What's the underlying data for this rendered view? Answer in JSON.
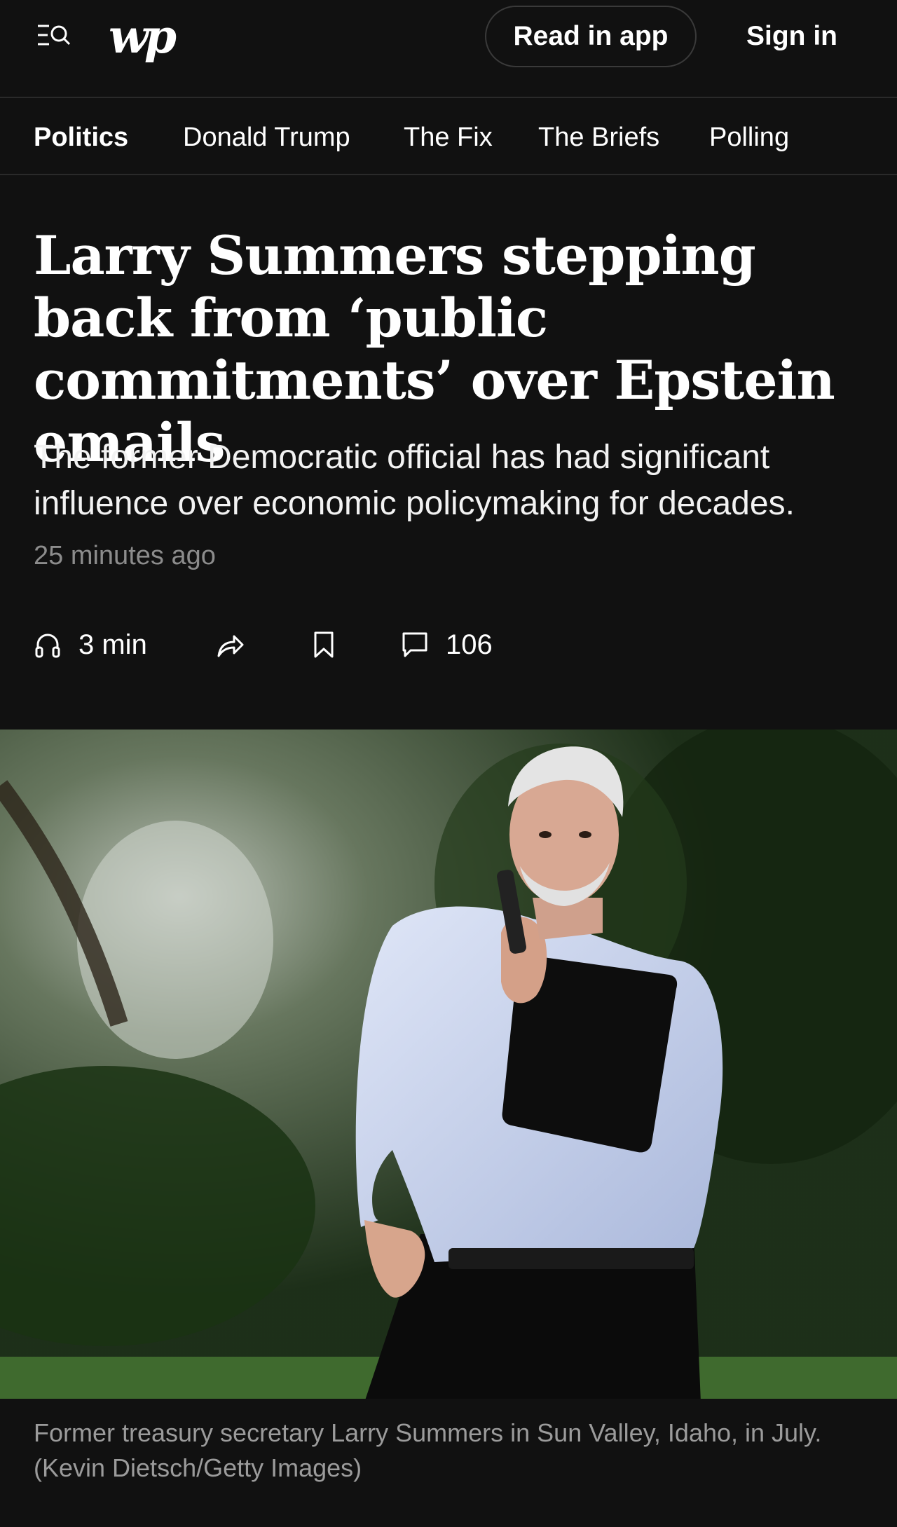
{
  "header": {
    "menu_icon": "menu-search-icon",
    "logo_text": "wp",
    "read_in_app_label": "Read in app",
    "sign_in_label": "Sign in"
  },
  "subnav": {
    "items": [
      {
        "label": "Politics",
        "active": true
      },
      {
        "label": "Donald Trump",
        "active": false
      },
      {
        "label": "The Fix",
        "active": false
      },
      {
        "label": "The Briefs",
        "active": false
      },
      {
        "label": "Polling",
        "active": false
      }
    ]
  },
  "article": {
    "headline": "Larry Summers stepping back from ‘public commitments’ over Epstein emails",
    "dek": "The former Democratic official has had significant influence over economic policymaking for decades.",
    "timestamp": "25 minutes ago",
    "actions": {
      "listen_icon": "headphones-icon",
      "listen_label": "3 min",
      "share_icon": "share-icon",
      "save_icon": "bookmark-icon",
      "comments_icon": "comment-icon",
      "comments_count": "106"
    },
    "image": {
      "caption": "Former treasury secretary Larry Summers in Sun Valley, Idaho, in July. (Kevin Dietsch/Getty Images)"
    }
  },
  "colors": {
    "background": "#111111",
    "divider": "#2a2a2a",
    "muted_text": "#8c8c8c",
    "caption_text": "#9b9b9b"
  }
}
